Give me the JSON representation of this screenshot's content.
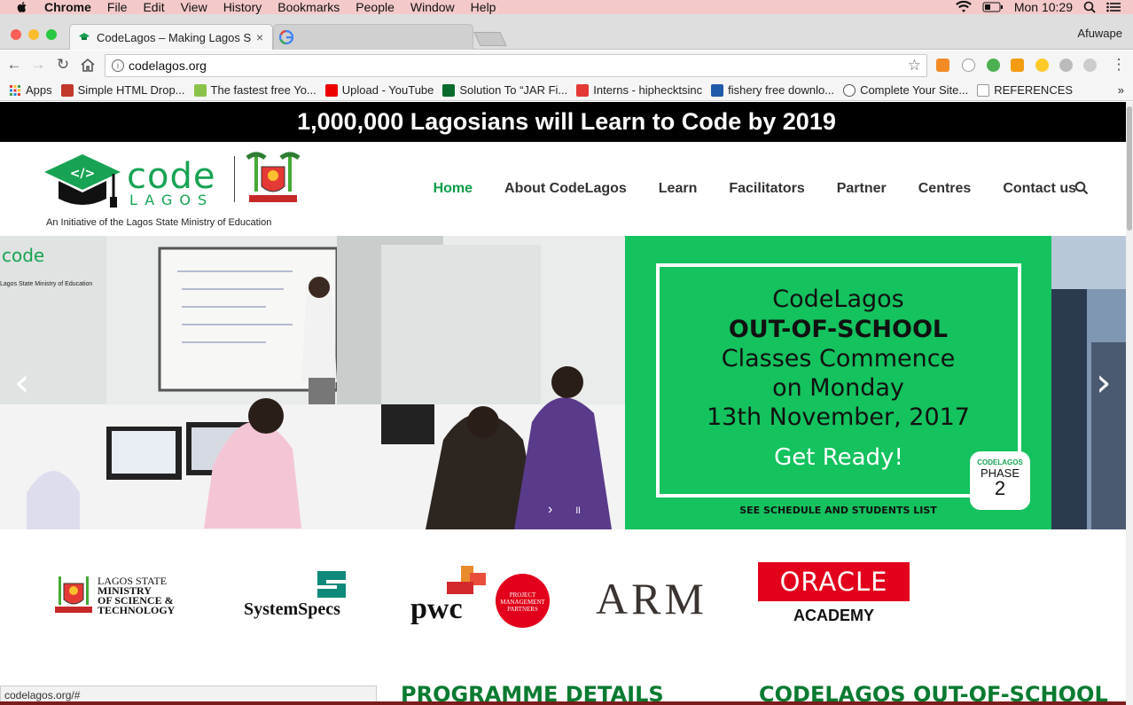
{
  "menubar": {
    "app": "Chrome",
    "items": [
      "File",
      "Edit",
      "View",
      "History",
      "Bookmarks",
      "People",
      "Window",
      "Help"
    ],
    "clock": "Mon 10:29"
  },
  "tabs": {
    "active_title": "CodeLagos – Making Lagos S",
    "profile": "Afuwape"
  },
  "toolbar": {
    "url": "codelagos.org"
  },
  "bookmarks": [
    {
      "label": "Apps",
      "color": "#e44"
    },
    {
      "label": "Simple HTML Drop...",
      "color": "#c0392b"
    },
    {
      "label": "The fastest free Yo...",
      "color": "#8bc34a"
    },
    {
      "label": "Upload - YouTube",
      "color": "#e00"
    },
    {
      "label": "Solution To “JAR Fi...",
      "color": "#0a6b2c"
    },
    {
      "label": "Interns - hiphecktsinc",
      "color": "#e53935"
    },
    {
      "label": "fishery free downlo...",
      "color": "#1e5aa8"
    },
    {
      "label": "Complete Your Site...",
      "color": "#555"
    },
    {
      "label": "REFERENCES",
      "color": "#999"
    }
  ],
  "site": {
    "banner": "1,000,000 Lagosians will Learn to Code by 2019",
    "logo_code": "code",
    "logo_lagos": "LAGOS",
    "tagline": "An Initiative of the Lagos State Ministry of Education",
    "nav": [
      "Home",
      "About CodeLagos",
      "Learn",
      "Facilitators",
      "Partner",
      "Centres",
      "Contact us"
    ],
    "photo_logo": "code",
    "photo_logo_sub": "Lagos State Ministry of Education"
  },
  "hero": {
    "line1": "CodeLagos",
    "line2": "OUT-OF-SCHOOL",
    "line3": "Classes Commence",
    "line4": "on Monday",
    "line5": "13th November, 2017",
    "cta": "Get Ready!",
    "phase_top": "CODELAGOS",
    "phase_mid": "PHASE",
    "phase_num": "2",
    "footer": "SEE SCHEDULE AND STUDENTS LIST",
    "prev": "‹",
    "next": "›"
  },
  "partners": {
    "lagos": [
      "LAGOS STATE",
      "MINISTRY",
      "OF SCIENCE &",
      "TECHNOLOGY"
    ],
    "systemspecs": "SystemSpecs",
    "pwc": "pwc",
    "pwc_badge": "PROJECT MANAGEMENT PARTNERS",
    "arm": "ARM",
    "oracle": "ORACLE",
    "oracle_sub": "ACADEMY"
  },
  "status_url": "codelagos.org/#",
  "sections": {
    "left": "PROGRAMME DETAILS",
    "right": "CODELAGOS OUT-OF-SCHOOL"
  },
  "colors": {
    "brand_green": "#17a353",
    "hero_green": "#14c25e",
    "oracle_red": "#e2001a"
  }
}
